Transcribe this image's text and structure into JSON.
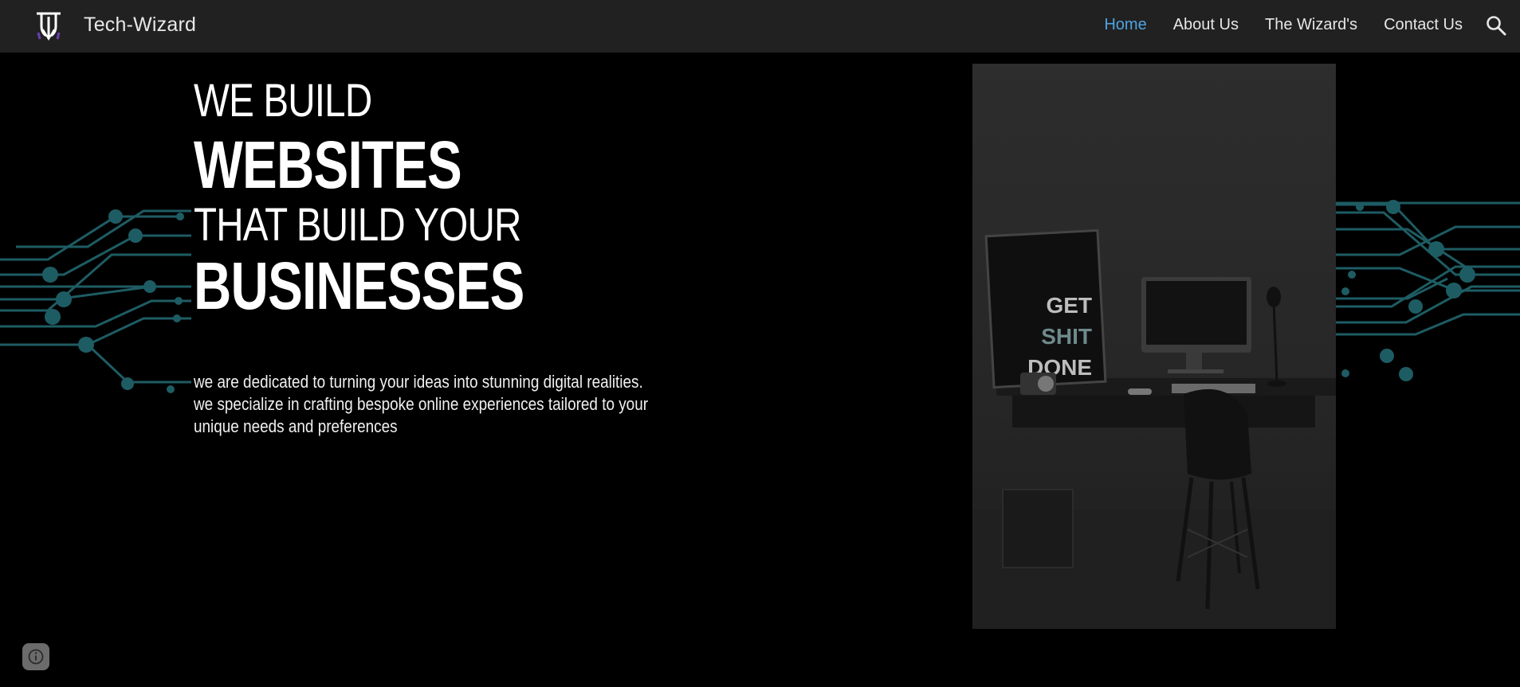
{
  "site": {
    "title": "Tech-Wizard"
  },
  "nav": {
    "items": [
      {
        "label": "Home",
        "active": true
      },
      {
        "label": "About Us",
        "active": false
      },
      {
        "label": "The Wizard's",
        "active": false
      },
      {
        "label": "Contact Us",
        "active": false
      }
    ]
  },
  "hero": {
    "line1": "WE BUILD",
    "line2": "WEBSITES",
    "line3": "THAT BUILD YOUR",
    "line4": "BUSINESSES",
    "desc_line1": "we are dedicated to turning your ideas into stunning digital realities.",
    "desc_line2": "we specialize in crafting bespoke online experiences tailored to your unique needs and preferences"
  },
  "photo": {
    "poster_line1": "GET",
    "poster_line2": "SHIT",
    "poster_line3": "DONE"
  },
  "icons": {
    "search": "search-icon",
    "info": "info-icon",
    "logo": "tech-wizard-logo"
  },
  "colors": {
    "background": "#000000",
    "topbar": "#212121",
    "nav_active": "#4fa3e0",
    "circuit": "#1e5c63"
  }
}
